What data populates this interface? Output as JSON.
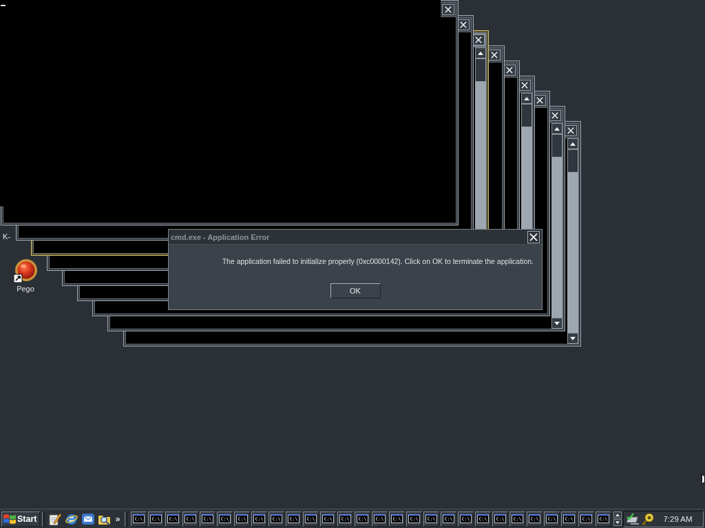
{
  "desktop_icons": [
    {
      "kind": "covered",
      "label": "K-"
    },
    {
      "kind": "shortcut",
      "label": "Pego"
    }
  ],
  "console_windows": [
    {
      "kind": "plain"
    },
    {
      "kind": "plain"
    },
    {
      "kind": "focused"
    },
    {
      "kind": "plain"
    },
    {
      "kind": "plain"
    },
    {
      "kind": "scrolling"
    },
    {
      "kind": "plain"
    },
    {
      "kind": "scrolling"
    },
    {
      "kind": "scrolling"
    }
  ],
  "dialog": {
    "title": "cmd.exe - Application Error",
    "message": "The application failed to initialize properly (0xc0000142). Click on OK to terminate the application.",
    "buttons": [
      "OK"
    ]
  },
  "taskbar": {
    "start_label": "Start",
    "quick_launch_more": "»",
    "task_buttons": [
      {
        "icon_text": "C:\\"
      },
      {
        "icon_text": "C:\\"
      },
      {
        "icon_text": "C:\\"
      },
      {
        "icon_text": "C:\\"
      },
      {
        "icon_text": "C:\\"
      },
      {
        "icon_text": "C:\\"
      },
      {
        "icon_text": "C:\\"
      },
      {
        "icon_text": "C:\\"
      },
      {
        "icon_text": "C:\\"
      },
      {
        "icon_text": "C:\\"
      },
      {
        "icon_text": "C:\\"
      },
      {
        "icon_text": "C:\\"
      },
      {
        "icon_text": "C:\\"
      },
      {
        "icon_text": "C:\\"
      },
      {
        "icon_text": "C:\\"
      },
      {
        "icon_text": "C:\\"
      },
      {
        "icon_text": "C:\\"
      },
      {
        "icon_text": "C:\\"
      },
      {
        "icon_text": "C:\\"
      },
      {
        "icon_text": "C:\\"
      },
      {
        "icon_text": "C:\\"
      },
      {
        "icon_text": "C:\\"
      },
      {
        "icon_text": "C:\\"
      },
      {
        "icon_text": "C:\\"
      },
      {
        "icon_text": "C:\\"
      },
      {
        "icon_text": "C:\\"
      },
      {
        "icon_text": "C:\\"
      },
      {
        "icon_text": "C:\\"
      }
    ],
    "clock": "7:29 AM"
  }
}
